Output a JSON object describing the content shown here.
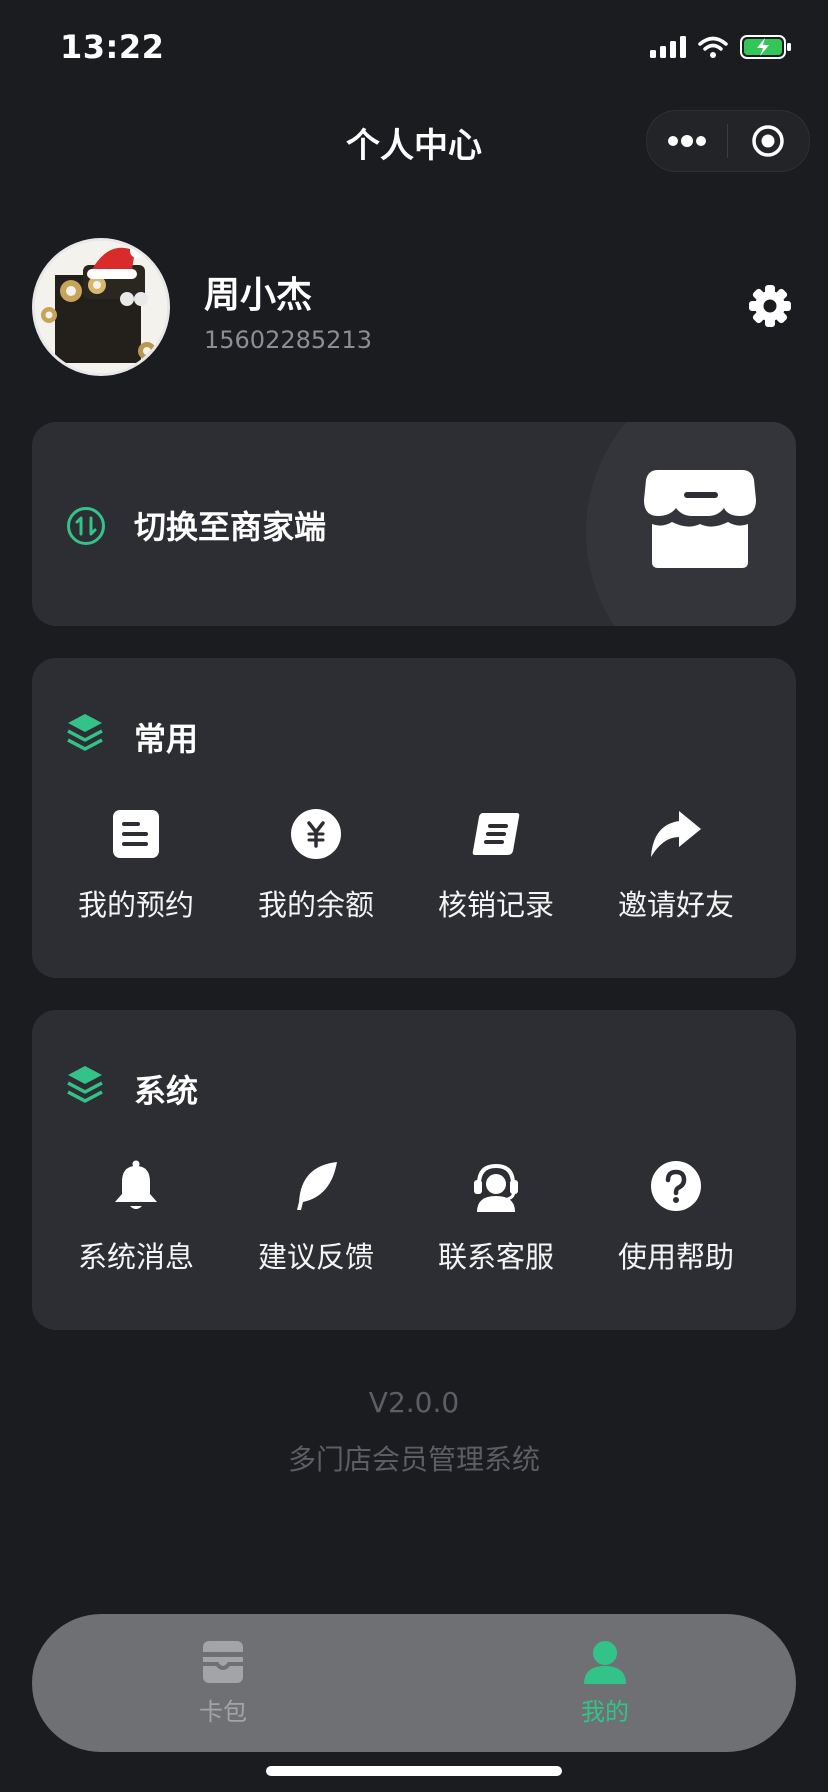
{
  "status_bar": {
    "time": "13:22"
  },
  "header": {
    "title": "个人中心"
  },
  "profile": {
    "name": "周小杰",
    "phone": "15602285213"
  },
  "switch_card": {
    "label": "切换至商家端"
  },
  "sections": [
    {
      "title": "常用",
      "items": [
        {
          "label": "我的预约",
          "icon": "appointment-icon"
        },
        {
          "label": "我的余额",
          "icon": "yen-coin-icon"
        },
        {
          "label": "核销记录",
          "icon": "record-icon"
        },
        {
          "label": "邀请好友",
          "icon": "share-arrow-icon"
        }
      ]
    },
    {
      "title": "系统",
      "items": [
        {
          "label": "系统消息",
          "icon": "bell-icon"
        },
        {
          "label": "建议反馈",
          "icon": "feather-icon"
        },
        {
          "label": "联系客服",
          "icon": "headset-icon"
        },
        {
          "label": "使用帮助",
          "icon": "question-icon"
        }
      ]
    }
  ],
  "footer": {
    "version": "V2.0.0",
    "app_name": "多门店会员管理系统"
  },
  "tabbar": [
    {
      "label": "卡包",
      "active": false
    },
    {
      "label": "我的",
      "active": true
    }
  ],
  "colors": {
    "accent": "#33c389",
    "background": "#1b1c20",
    "card": "#2d2e33",
    "tabbar": "#6f7073"
  }
}
